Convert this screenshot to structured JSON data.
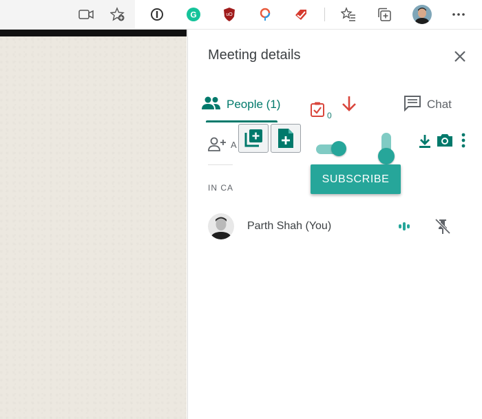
{
  "browser_toolbar": {
    "icons": [
      "video-icon",
      "favorites-add-icon",
      "password-manager-icon",
      "grammarly-icon",
      "ublock-icon",
      "location-extension-icon",
      "todoist-icon",
      "favorites-list-icon",
      "collections-icon",
      "profile-avatar",
      "more-menu-icon"
    ]
  },
  "panel": {
    "title": "Meeting details",
    "tabs": {
      "people": "People (1)",
      "chat": "Chat"
    },
    "tasks_count": "0",
    "add_person_truncated": "A",
    "subscribe_label": "SUBSCRIBE",
    "section_label": "IN CALL",
    "participants": [
      {
        "name": "Parth Shah (You)"
      }
    ]
  },
  "colors": {
    "accent": "#00796b",
    "teal_button": "#26a69a",
    "arrow_red": "#d9463c"
  }
}
